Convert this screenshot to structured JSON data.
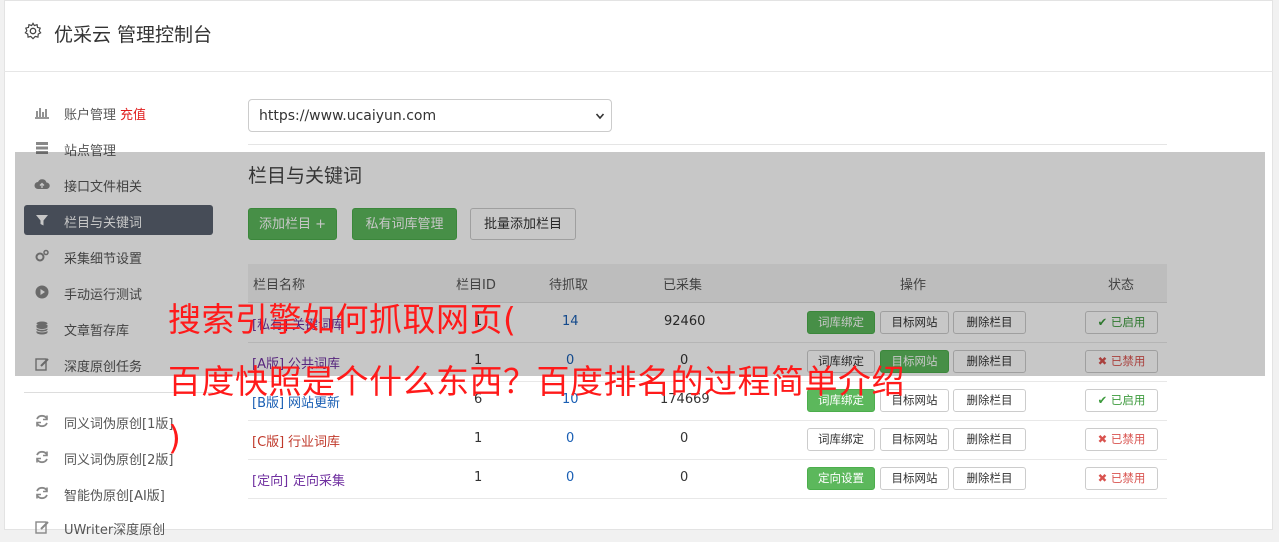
{
  "header": {
    "title": "优采云 管理控制台",
    "icon": "gear-icon"
  },
  "sidebar": {
    "items": [
      {
        "label": "账户管理",
        "extra": "充值",
        "icon": "bar-chart-icon"
      },
      {
        "label": "站点管理",
        "icon": "server-icon"
      },
      {
        "label": "接口文件相关",
        "icon": "cloud-upload-icon"
      },
      {
        "label": "栏目与关键词",
        "icon": "filter-icon",
        "active": true
      },
      {
        "label": "采集细节设置",
        "icon": "cogs-icon"
      },
      {
        "label": "手动运行测试",
        "icon": "play-circle-icon"
      },
      {
        "label": "文章暂存库",
        "icon": "database-icon"
      },
      {
        "label": "深度原创任务",
        "icon": "edit-icon"
      },
      {
        "label": "同义词伪原创[1版]",
        "icon": "refresh-icon"
      },
      {
        "label": "同义词伪原创[2版]",
        "icon": "refresh-icon"
      },
      {
        "label": "智能伪原创[AI版]",
        "icon": "refresh-icon"
      },
      {
        "label": "UWriter深度原创",
        "icon": "edit-icon"
      }
    ]
  },
  "site_select": {
    "value": "https://www.ucaiyun.com"
  },
  "section": {
    "title": "栏目与关键词",
    "buttons": {
      "add": "添加栏目 +",
      "private": "私有词库管理",
      "batch": "批量添加栏目"
    }
  },
  "table": {
    "headers": [
      "栏目名称",
      "栏目ID",
      "待抓取",
      "已采集",
      "操作",
      "状态"
    ],
    "rows": [
      {
        "tag": "[私有]",
        "name": "关键词库",
        "id": "1",
        "pending": "14",
        "collected": "92460",
        "bind": "词库绑定",
        "target": "目标网站",
        "delete": "删除栏目",
        "status": "已启用"
      },
      {
        "tag": "[A版]",
        "name": "公共词库",
        "id": "1",
        "pending": "0",
        "collected": "0",
        "bind": "词库绑定",
        "target": "目标网站",
        "delete": "删除栏目",
        "status": "已禁用"
      },
      {
        "tag": "[B版]",
        "name": "网站更新",
        "id": "6",
        "pending": "10",
        "collected": "174669",
        "bind": "词库绑定",
        "target": "目标网站",
        "delete": "删除栏目",
        "status": "已启用"
      },
      {
        "tag": "[C版]",
        "name": "行业词库",
        "id": "1",
        "pending": "0",
        "collected": "0",
        "bind": "词库绑定",
        "target": "目标网站",
        "delete": "删除栏目",
        "status": "已禁用"
      },
      {
        "tag": "[定向]",
        "name": "定向采集",
        "id": "1",
        "pending": "0",
        "collected": "0",
        "bind": "定向设置",
        "target": "目标网站",
        "delete": "删除栏目",
        "status": "已禁用"
      }
    ]
  },
  "overlay_text": {
    "line1": "搜索引擎如何抓取网页(",
    "line2": "百度快照是个什么东西？百度排名的过程简单介绍",
    "line3": ")"
  },
  "colors": {
    "accent_green": "#5cb85c",
    "sidebar_active": "#5a6270",
    "overlay_text": "#ff1a1a",
    "link_blue": "#1a5fb4",
    "tag_purple": "#7030a0"
  }
}
